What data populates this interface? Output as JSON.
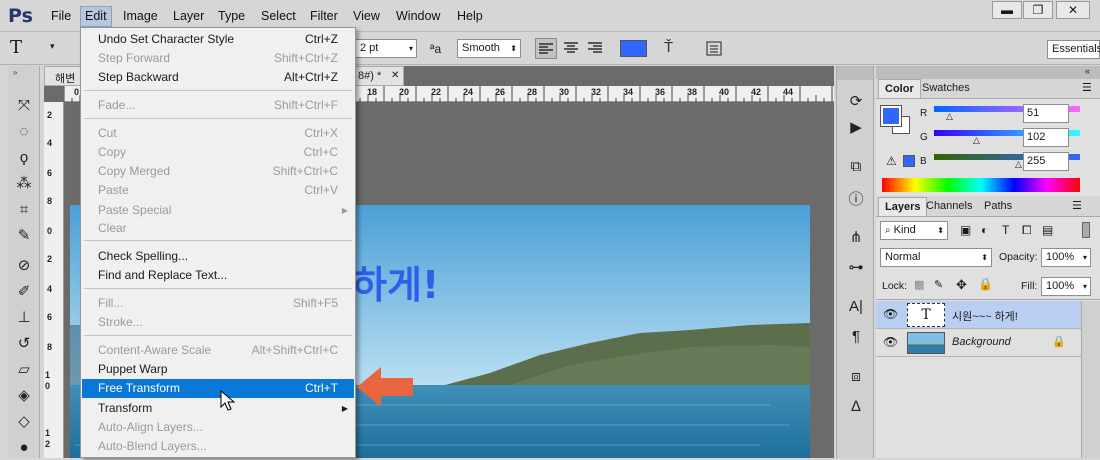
{
  "app": {
    "logo": "Ps"
  },
  "menubar": {
    "items": [
      "File",
      "Edit",
      "Image",
      "Layer",
      "Type",
      "Select",
      "Filter",
      "View",
      "Window",
      "Help"
    ],
    "window_buttons": [
      "▬",
      "❐",
      "✕"
    ]
  },
  "options_bar": {
    "tool_icon": "T",
    "font_size": "2 pt",
    "aa_icon": "ªa",
    "antialias": "Smooth",
    "text_color": "#3366ff",
    "workspace": "Essentials"
  },
  "document": {
    "tab_left": "해변",
    "tab_suffix": "8#) *",
    "tab_close": "✕",
    "canvas_text": "하게!",
    "ruler_top": [
      "0",
      "18",
      "20",
      "22",
      "24",
      "26",
      "28",
      "30",
      "32",
      "34",
      "36",
      "38",
      "40",
      "42",
      "44"
    ],
    "ruler_left": [
      "2",
      "4",
      "6",
      "8",
      "0",
      "2",
      "4",
      "6",
      "8",
      "1 0",
      "1 2"
    ]
  },
  "edit_menu": {
    "items": [
      {
        "label": "Undo Set Character Style",
        "shortcut": "Ctrl+Z",
        "disabled": false
      },
      {
        "label": "Step Forward",
        "shortcut": "Shift+Ctrl+Z",
        "disabled": true
      },
      {
        "label": "Step Backward",
        "shortcut": "Alt+Ctrl+Z",
        "disabled": false
      },
      {
        "label": "Fade...",
        "shortcut": "Shift+Ctrl+F",
        "disabled": true
      },
      {
        "label": "Cut",
        "shortcut": "Ctrl+X",
        "disabled": true
      },
      {
        "label": "Copy",
        "shortcut": "Ctrl+C",
        "disabled": true
      },
      {
        "label": "Copy Merged",
        "shortcut": "Shift+Ctrl+C",
        "disabled": true
      },
      {
        "label": "Paste",
        "shortcut": "Ctrl+V",
        "disabled": true
      },
      {
        "label": "Paste Special",
        "shortcut": "",
        "disabled": true,
        "submenu": true
      },
      {
        "label": "Clear",
        "shortcut": "",
        "disabled": true
      },
      {
        "label": "Check Spelling...",
        "shortcut": "",
        "disabled": false
      },
      {
        "label": "Find and Replace Text...",
        "shortcut": "",
        "disabled": false
      },
      {
        "label": "Fill...",
        "shortcut": "Shift+F5",
        "disabled": true
      },
      {
        "label": "Stroke...",
        "shortcut": "",
        "disabled": true
      },
      {
        "label": "Content-Aware Scale",
        "shortcut": "Alt+Shift+Ctrl+C",
        "disabled": true
      },
      {
        "label": "Puppet Warp",
        "shortcut": "",
        "disabled": false
      },
      {
        "label": "Free Transform",
        "shortcut": "Ctrl+T",
        "disabled": false,
        "highlighted": true
      },
      {
        "label": "Transform",
        "shortcut": "",
        "disabled": false,
        "submenu": true
      },
      {
        "label": "Auto-Align Layers...",
        "shortcut": "",
        "disabled": true
      },
      {
        "label": "Auto-Blend Layers...",
        "shortcut": "",
        "disabled": true
      }
    ]
  },
  "color_panel": {
    "tabs": [
      "Color",
      "Swatches"
    ],
    "channels": [
      {
        "label": "R",
        "value": "51"
      },
      {
        "label": "G",
        "value": "102"
      },
      {
        "label": "B",
        "value": "255"
      }
    ],
    "foreground": "#3366ff"
  },
  "layers_panel": {
    "tabs": [
      "Layers",
      "Channels",
      "Paths"
    ],
    "kind": "Kind",
    "blend_mode": "Normal",
    "opacity_label": "Opacity:",
    "opacity": "100%",
    "lock_label": "Lock:",
    "fill_label": "Fill:",
    "fill": "100%",
    "layers": [
      {
        "name": "시원~~~ 하게!",
        "type": "text",
        "selected": true
      },
      {
        "name": "Background",
        "type": "image",
        "locked": true
      }
    ]
  },
  "accent_colors": {
    "highlight": "#0a78d6",
    "arrow": "#e8653f",
    "layer_selected": "#b9cff2"
  }
}
